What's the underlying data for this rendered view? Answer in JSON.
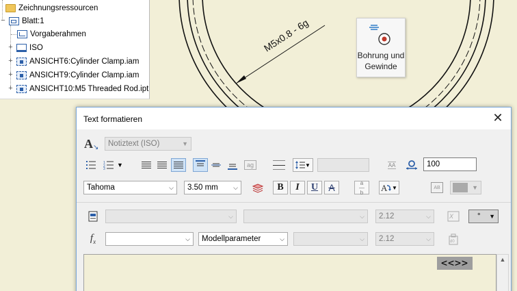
{
  "browser": {
    "items": [
      {
        "label": "Zeichnungsressourcen",
        "icon": "folder-icon"
      },
      {
        "label": "Blatt:1",
        "icon": "sheet-icon"
      },
      {
        "label": "Vorgaberahmen",
        "icon": "frame-icon"
      },
      {
        "label": "ISO",
        "icon": "title-block-icon"
      },
      {
        "label": "ANSICHT6:Cylinder Clamp.iam",
        "icon": "drawing-view-icon"
      },
      {
        "label": "ANSICHT9:Cylinder Clamp.iam",
        "icon": "drawing-view-icon"
      },
      {
        "label": "ANSICHT10:M5 Threaded Rod.ipt",
        "icon": "drawing-view-icon"
      }
    ]
  },
  "drawing": {
    "dimension_text": "M5x0.8 - 6g"
  },
  "tooltip": {
    "line1": "Bohrung und",
    "line2": "Gewinde",
    "icon": "hole-thread-icon"
  },
  "dialog": {
    "title": "Text formatieren",
    "style": "Notiztext (ISO)",
    "font": "Tahoma",
    "font_size": "3.50 mm",
    "stretch_value": "100",
    "precision1": "2.12",
    "precision2": "2.12",
    "parameter_type": "Modellparameter",
    "degree_symbol": "°",
    "bold_label": "B",
    "italic_label": "I",
    "underline_label": "U",
    "strike_label": "A",
    "editor_text": "<<>>"
  },
  "colors": {
    "drawing_bg": "#f2efd7",
    "accent": "#2c5fa8",
    "pressed": "#cfe3f7"
  }
}
